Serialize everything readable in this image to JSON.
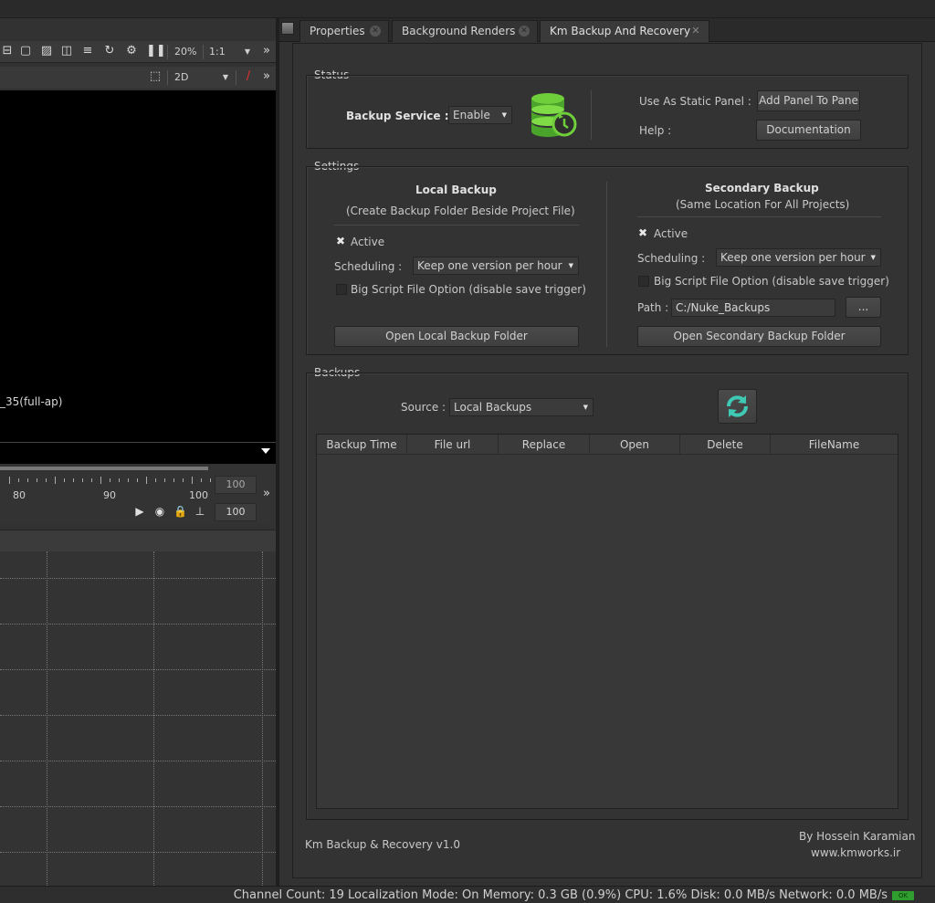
{
  "viewer": {
    "zoom": "20%",
    "ratio": "1:1",
    "view_mode": "2D",
    "overlay_label": "_35(full-ap)"
  },
  "timeline": {
    "ticks": [
      "80",
      "90",
      "100"
    ],
    "end_frame_top": "100",
    "end_frame_bottom": "100"
  },
  "tabs": [
    {
      "label": "Properties"
    },
    {
      "label": "Background Renders"
    },
    {
      "label": "Km Backup And Recovery"
    }
  ],
  "status_group": {
    "title": "Status",
    "backup_service_label": "Backup Service :",
    "backup_service_value": "Enable",
    "static_panel_label": "Use As Static Panel :",
    "add_panel_button": "Add Panel To Pane",
    "help_label": "Help :",
    "documentation_button": "Documentation"
  },
  "settings_group": {
    "title": "Settings",
    "local": {
      "title": "Local  Backup",
      "subtitle": "(Create Backup Folder Beside Project File)",
      "active_label": "Active",
      "scheduling_label": "Scheduling :",
      "scheduling_value": "Keep one version per hour",
      "big_script_label": "Big Script File Option (disable save trigger)",
      "open_button": "Open Local Backup Folder"
    },
    "secondary": {
      "title": "Secondary Backup",
      "subtitle": "(Same Location For All Projects)",
      "active_label": "Active",
      "scheduling_label": "Scheduling :",
      "scheduling_value": "Keep one version per hour",
      "big_script_label": "Big Script File Option (disable save trigger)",
      "path_label": "Path :",
      "path_value": "C:/Nuke_Backups",
      "browse_button": "...",
      "open_button": "Open Secondary Backup Folder"
    }
  },
  "backups_group": {
    "title": "Backups",
    "source_label": "Source :",
    "source_value": "Local Backups",
    "columns": [
      "Backup Time",
      "File url",
      "Replace",
      "Open",
      "Delete",
      "FileName"
    ]
  },
  "footer": {
    "version": "Km Backup & Recovery v1.0",
    "author": "By Hossein Karamian",
    "website": "www.kmworks.ir"
  },
  "statusbar": {
    "text": "Channel Count: 19 Localization Mode: On Memory: 0.3 GB (0.9%) CPU: 1.6% Disk: 0.0 MB/s Network: 0.0 MB/s",
    "ok_badge": "OK"
  }
}
